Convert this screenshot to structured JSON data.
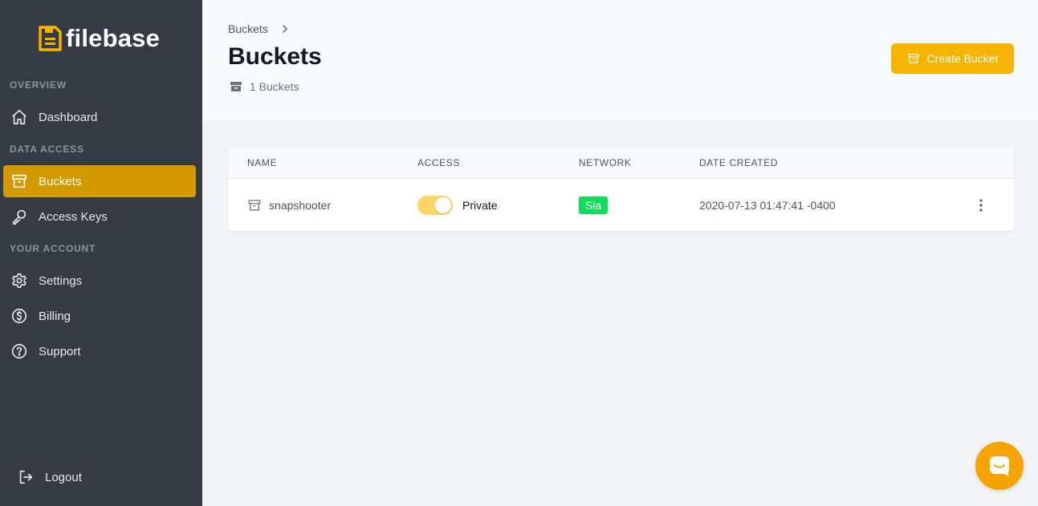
{
  "brand": {
    "name": "filebase",
    "accent": "#f6b400"
  },
  "sidebar": {
    "sections": {
      "overview": "OVERVIEW",
      "data_access": "DATA ACCESS",
      "your_account": "YOUR ACCOUNT"
    },
    "items": {
      "dashboard": {
        "label": "Dashboard",
        "icon": "home-icon"
      },
      "buckets": {
        "label": "Buckets",
        "icon": "archive-icon",
        "active": true
      },
      "access_keys": {
        "label": "Access Keys",
        "icon": "key-icon"
      },
      "settings": {
        "label": "Settings",
        "icon": "gear-icon"
      },
      "billing": {
        "label": "Billing",
        "icon": "dollar-circle-icon"
      },
      "support": {
        "label": "Support",
        "icon": "question-circle-icon"
      }
    },
    "logout": {
      "label": "Logout",
      "icon": "logout-icon"
    }
  },
  "header": {
    "breadcrumb": "Buckets",
    "title": "Buckets",
    "count": "1 Buckets",
    "create_button": "Create Bucket"
  },
  "table": {
    "columns": {
      "name": "NAME",
      "access": "ACCESS",
      "network": "NETWORK",
      "date_created": "DATE CREATED"
    },
    "rows": [
      {
        "name": "snapshooter",
        "access": "Private",
        "access_toggle_on": true,
        "network": "Sia",
        "date_created": "2020-07-13 01:47:41 -0400"
      }
    ]
  },
  "colors": {
    "sidebar_bg": "#363b43",
    "active_item": "#d39a00",
    "network_badge": "#0ddd58",
    "chat_button": "#f6a400"
  }
}
